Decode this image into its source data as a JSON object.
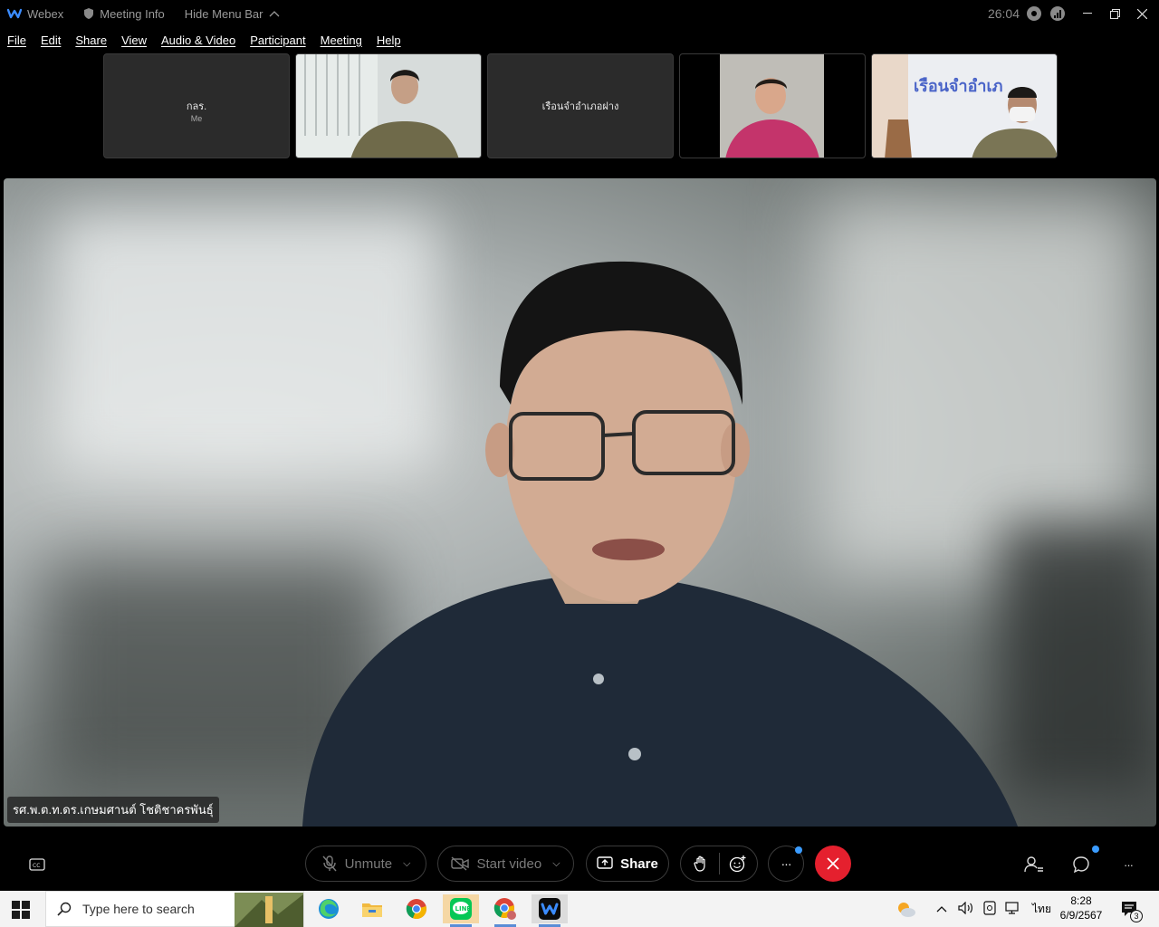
{
  "titlebar": {
    "app_name": "Webex",
    "meeting_info": "Meeting Info",
    "hide_menu": "Hide Menu Bar",
    "timer": "26:04"
  },
  "menu": [
    "File",
    "Edit",
    "Share",
    "View",
    "Audio & Video",
    "Participant",
    "Meeting",
    "Help"
  ],
  "thumbnails": [
    {
      "name": "กลร.",
      "sub": "Me",
      "type": "text"
    },
    {
      "type": "video"
    },
    {
      "name": "เรือนจำอำเภอฝาง",
      "type": "text"
    },
    {
      "type": "video"
    },
    {
      "type": "video",
      "banner": "เรือนจำอำเภ"
    }
  ],
  "main": {
    "speaker_name": "รศ.พ.ต.ท.ดร.เกษมศานต์ โชติชาครพันธุ์"
  },
  "controls": {
    "unmute": "Unmute",
    "start_video": "Start video",
    "share": "Share",
    "more": "···"
  },
  "taskbar": {
    "search_placeholder": "Type here to search",
    "lang": "ไทย",
    "time": "8:28",
    "date": "6/9/2567",
    "notif_count": "3"
  },
  "colors": {
    "end_call": "#e5202e",
    "badge_blue": "#3b9cff"
  }
}
